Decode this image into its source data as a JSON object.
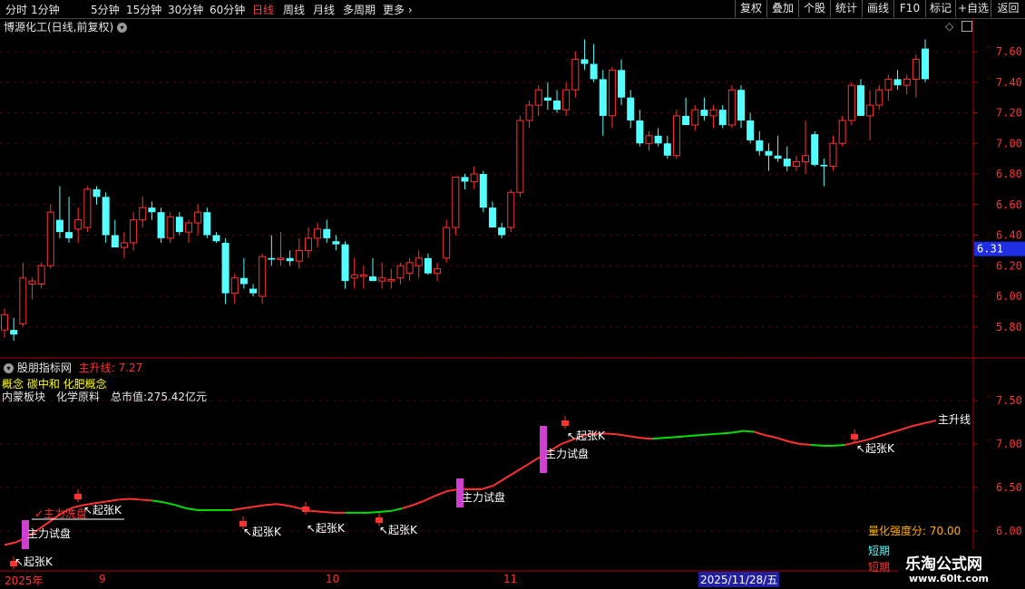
{
  "toolbar": {
    "periods": [
      "分时",
      "1分钟",
      "5分钟",
      "15分钟",
      "30分钟",
      "60分钟",
      "日线",
      "周线",
      "月线",
      "多周期",
      "更多 ›"
    ],
    "active_period": "日线",
    "right_buttons": [
      "复权",
      "叠加",
      "个股",
      "统计",
      "画线",
      "F10",
      "标记",
      "+自选",
      "返回"
    ]
  },
  "main_chart": {
    "title": "博源化工(日线,前复权)",
    "price_ticks": [
      "7.60",
      "7.40",
      "7.20",
      "7.00",
      "6.80",
      "6.60",
      "6.40",
      "6.20",
      "6.00",
      "5.80"
    ],
    "current_price": "6.31",
    "candles": [
      {
        "o": 5.78,
        "h": 5.92,
        "l": 5.73,
        "c": 5.88
      },
      {
        "o": 5.78,
        "h": 5.86,
        "l": 5.71,
        "c": 5.75
      },
      {
        "o": 5.82,
        "h": 6.22,
        "l": 5.8,
        "c": 6.12
      },
      {
        "o": 6.08,
        "h": 6.12,
        "l": 5.98,
        "c": 6.1
      },
      {
        "o": 6.08,
        "h": 6.22,
        "l": 6.05,
        "c": 6.2
      },
      {
        "o": 6.2,
        "h": 6.6,
        "l": 6.18,
        "c": 6.55
      },
      {
        "o": 6.5,
        "h": 6.72,
        "l": 6.38,
        "c": 6.42
      },
      {
        "o": 6.42,
        "h": 6.65,
        "l": 6.35,
        "c": 6.38
      },
      {
        "o": 6.44,
        "h": 6.58,
        "l": 6.35,
        "c": 6.5
      },
      {
        "o": 6.45,
        "h": 6.72,
        "l": 6.42,
        "c": 6.7
      },
      {
        "o": 6.7,
        "h": 6.72,
        "l": 6.6,
        "c": 6.65
      },
      {
        "o": 6.65,
        "h": 6.68,
        "l": 6.35,
        "c": 6.4
      },
      {
        "o": 6.4,
        "h": 6.5,
        "l": 6.33,
        "c": 6.32
      },
      {
        "o": 6.32,
        "h": 6.42,
        "l": 6.25,
        "c": 6.35
      },
      {
        "o": 6.35,
        "h": 6.55,
        "l": 6.3,
        "c": 6.5
      },
      {
        "o": 6.5,
        "h": 6.65,
        "l": 6.45,
        "c": 6.58
      },
      {
        "o": 6.58,
        "h": 6.62,
        "l": 6.5,
        "c": 6.55
      },
      {
        "o": 6.55,
        "h": 6.58,
        "l": 6.35,
        "c": 6.38
      },
      {
        "o": 6.38,
        "h": 6.55,
        "l": 6.35,
        "c": 6.52
      },
      {
        "o": 6.52,
        "h": 6.55,
        "l": 6.4,
        "c": 6.42
      },
      {
        "o": 6.42,
        "h": 6.5,
        "l": 6.35,
        "c": 6.48
      },
      {
        "o": 6.48,
        "h": 6.6,
        "l": 6.4,
        "c": 6.55
      },
      {
        "o": 6.55,
        "h": 6.58,
        "l": 6.38,
        "c": 6.4
      },
      {
        "o": 6.4,
        "h": 6.42,
        "l": 6.35,
        "c": 6.36
      },
      {
        "o": 6.35,
        "h": 6.38,
        "l": 5.95,
        "c": 6.02
      },
      {
        "o": 6.02,
        "h": 6.15,
        "l": 5.95,
        "c": 6.12
      },
      {
        "o": 6.12,
        "h": 6.25,
        "l": 6.05,
        "c": 6.08
      },
      {
        "o": 6.05,
        "h": 6.08,
        "l": 6.0,
        "c": 6.02
      },
      {
        "o": 6.0,
        "h": 6.28,
        "l": 5.95,
        "c": 6.26
      },
      {
        "o": 6.25,
        "h": 6.4,
        "l": 6.2,
        "c": 6.24
      },
      {
        "o": 6.24,
        "h": 6.42,
        "l": 6.2,
        "c": 6.25
      },
      {
        "o": 6.25,
        "h": 6.3,
        "l": 6.2,
        "c": 6.23
      },
      {
        "o": 6.23,
        "h": 6.38,
        "l": 6.18,
        "c": 6.3
      },
      {
        "o": 6.3,
        "h": 6.45,
        "l": 6.25,
        "c": 6.38
      },
      {
        "o": 6.38,
        "h": 6.48,
        "l": 6.32,
        "c": 6.44
      },
      {
        "o": 6.44,
        "h": 6.5,
        "l": 6.35,
        "c": 6.38
      },
      {
        "o": 6.36,
        "h": 6.4,
        "l": 6.3,
        "c": 6.34
      },
      {
        "o": 6.34,
        "h": 6.36,
        "l": 6.05,
        "c": 6.1
      },
      {
        "o": 6.12,
        "h": 6.25,
        "l": 6.05,
        "c": 6.14
      },
      {
        "o": 6.13,
        "h": 6.2,
        "l": 6.05,
        "c": 6.14
      },
      {
        "o": 6.13,
        "h": 6.25,
        "l": 6.1,
        "c": 6.1
      },
      {
        "o": 6.1,
        "h": 6.22,
        "l": 6.05,
        "c": 6.12
      },
      {
        "o": 6.1,
        "h": 6.18,
        "l": 6.05,
        "c": 6.11
      },
      {
        "o": 6.12,
        "h": 6.22,
        "l": 6.08,
        "c": 6.2
      },
      {
        "o": 6.15,
        "h": 6.25,
        "l": 6.1,
        "c": 6.22
      },
      {
        "o": 6.2,
        "h": 6.3,
        "l": 6.12,
        "c": 6.25
      },
      {
        "o": 6.25,
        "h": 6.28,
        "l": 6.14,
        "c": 6.15
      },
      {
        "o": 6.15,
        "h": 6.22,
        "l": 6.1,
        "c": 6.18
      },
      {
        "o": 6.25,
        "h": 6.5,
        "l": 6.22,
        "c": 6.45
      },
      {
        "o": 6.45,
        "h": 6.78,
        "l": 6.4,
        "c": 6.78
      },
      {
        "o": 6.78,
        "h": 6.8,
        "l": 6.7,
        "c": 6.75
      },
      {
        "o": 6.75,
        "h": 6.85,
        "l": 6.7,
        "c": 6.8
      },
      {
        "o": 6.8,
        "h": 6.82,
        "l": 6.55,
        "c": 6.58
      },
      {
        "o": 6.58,
        "h": 6.62,
        "l": 6.45,
        "c": 6.45
      },
      {
        "o": 6.45,
        "h": 6.48,
        "l": 6.38,
        "c": 6.4
      },
      {
        "o": 6.45,
        "h": 6.7,
        "l": 6.42,
        "c": 6.68
      },
      {
        "o": 6.68,
        "h": 7.18,
        "l": 6.65,
        "c": 7.15
      },
      {
        "o": 7.15,
        "h": 7.28,
        "l": 7.1,
        "c": 7.25
      },
      {
        "o": 7.25,
        "h": 7.38,
        "l": 7.18,
        "c": 7.35
      },
      {
        "o": 7.3,
        "h": 7.4,
        "l": 7.22,
        "c": 7.28
      },
      {
        "o": 7.28,
        "h": 7.35,
        "l": 7.2,
        "c": 7.22
      },
      {
        "o": 7.22,
        "h": 7.4,
        "l": 7.18,
        "c": 7.35
      },
      {
        "o": 7.35,
        "h": 7.6,
        "l": 7.3,
        "c": 7.55
      },
      {
        "o": 7.55,
        "h": 7.68,
        "l": 7.48,
        "c": 7.52
      },
      {
        "o": 7.52,
        "h": 7.65,
        "l": 7.4,
        "c": 7.42
      },
      {
        "o": 7.42,
        "h": 7.48,
        "l": 7.05,
        "c": 7.18
      },
      {
        "o": 7.18,
        "h": 7.5,
        "l": 7.1,
        "c": 7.48
      },
      {
        "o": 7.48,
        "h": 7.55,
        "l": 7.25,
        "c": 7.3
      },
      {
        "o": 7.3,
        "h": 7.35,
        "l": 7.1,
        "c": 7.15
      },
      {
        "o": 7.15,
        "h": 7.22,
        "l": 6.98,
        "c": 7.0
      },
      {
        "o": 7.0,
        "h": 7.08,
        "l": 6.95,
        "c": 7.05
      },
      {
        "o": 7.05,
        "h": 7.1,
        "l": 6.98,
        "c": 7.0
      },
      {
        "o": 7.0,
        "h": 7.05,
        "l": 6.9,
        "c": 6.92
      },
      {
        "o": 6.92,
        "h": 7.22,
        "l": 6.9,
        "c": 7.18
      },
      {
        "o": 7.18,
        "h": 7.3,
        "l": 7.12,
        "c": 7.12
      },
      {
        "o": 7.12,
        "h": 7.25,
        "l": 7.08,
        "c": 7.22
      },
      {
        "o": 7.22,
        "h": 7.3,
        "l": 7.15,
        "c": 7.18
      },
      {
        "o": 7.18,
        "h": 7.25,
        "l": 7.1,
        "c": 7.22
      },
      {
        "o": 7.22,
        "h": 7.25,
        "l": 7.1,
        "c": 7.12
      },
      {
        "o": 7.12,
        "h": 7.38,
        "l": 7.1,
        "c": 7.35
      },
      {
        "o": 7.35,
        "h": 7.38,
        "l": 7.1,
        "c": 7.15
      },
      {
        "o": 7.15,
        "h": 7.2,
        "l": 7.0,
        "c": 7.02
      },
      {
        "o": 7.02,
        "h": 7.08,
        "l": 6.92,
        "c": 6.95
      },
      {
        "o": 6.95,
        "h": 7.0,
        "l": 6.82,
        "c": 6.92
      },
      {
        "o": 6.92,
        "h": 7.05,
        "l": 6.88,
        "c": 6.9
      },
      {
        "o": 6.9,
        "h": 6.98,
        "l": 6.82,
        "c": 6.85
      },
      {
        "o": 6.85,
        "h": 6.92,
        "l": 6.82,
        "c": 6.88
      },
      {
        "o": 6.88,
        "h": 7.15,
        "l": 6.8,
        "c": 6.92
      },
      {
        "o": 7.06,
        "h": 7.08,
        "l": 6.85,
        "c": 6.86
      },
      {
        "o": 6.86,
        "h": 6.9,
        "l": 6.72,
        "c": 6.85
      },
      {
        "o": 6.85,
        "h": 7.05,
        "l": 6.82,
        "c": 7.0
      },
      {
        "o": 7.0,
        "h": 7.18,
        "l": 6.98,
        "c": 7.15
      },
      {
        "o": 7.15,
        "h": 7.4,
        "l": 7.12,
        "c": 7.38
      },
      {
        "o": 7.38,
        "h": 7.42,
        "l": 7.18,
        "c": 7.18
      },
      {
        "o": 7.18,
        "h": 7.35,
        "l": 7.02,
        "c": 7.25
      },
      {
        "o": 7.25,
        "h": 7.38,
        "l": 7.22,
        "c": 7.35
      },
      {
        "o": 7.35,
        "h": 7.45,
        "l": 7.28,
        "c": 7.42
      },
      {
        "o": 7.42,
        "h": 7.48,
        "l": 7.35,
        "c": 7.38
      },
      {
        "o": 7.38,
        "h": 7.45,
        "l": 7.32,
        "c": 7.42
      },
      {
        "o": 7.42,
        "h": 7.58,
        "l": 7.3,
        "c": 7.55
      },
      {
        "o": 7.62,
        "h": 7.68,
        "l": 7.4,
        "c": 7.42
      }
    ]
  },
  "indicator": {
    "name": "股朋指标网",
    "line_label": "主升线",
    "line_value": "7.27",
    "concept_text": "概念 碳中和 化肥概念",
    "sector_text": "内蒙板块　化学原料　总市值:275.42亿元",
    "ticks": [
      "7.50",
      "7.00",
      "6.50",
      "6.00"
    ],
    "line_values": [
      5.84,
      5.87,
      5.93,
      6.02,
      6.11,
      6.2,
      6.27,
      6.3,
      6.32,
      6.34,
      6.36,
      6.37,
      6.36,
      6.35,
      6.33,
      6.3,
      6.26,
      6.24,
      6.24,
      6.24,
      6.24,
      6.26,
      6.28,
      6.3,
      6.31,
      6.29,
      6.26,
      6.23,
      6.22,
      6.21,
      6.21,
      6.21,
      6.21,
      6.22,
      6.23,
      6.26,
      6.3,
      6.35,
      6.41,
      6.46,
      6.48,
      6.48,
      6.48,
      6.52,
      6.6,
      6.68,
      6.76,
      6.84,
      6.92,
      7.0,
      7.05,
      7.1,
      7.12,
      7.12,
      7.11,
      7.09,
      7.07,
      7.06,
      7.07,
      7.08,
      7.09,
      7.1,
      7.11,
      7.12,
      7.13,
      7.15,
      7.14,
      7.1,
      7.07,
      7.03,
      7.0,
      6.99,
      6.98,
      6.98,
      6.99,
      7.02,
      7.05,
      7.09,
      7.13,
      7.17,
      7.21,
      7.24,
      7.27
    ],
    "green_ranges": [
      [
        13,
        20
      ],
      [
        30,
        35
      ],
      [
        57,
        66
      ],
      [
        71,
        74
      ]
    ],
    "markers_qizhang": [
      "起张K",
      "起张K",
      "起张K",
      "起张K",
      "起张K",
      "起张K",
      "起张K"
    ],
    "marker_shitai": "主力试盘",
    "marker_xipan": "主力洗盘",
    "end_label": "主升线",
    "score_label": "量化强度分: 70.00",
    "short_term_1": "短期",
    "short_term_2": "短期"
  },
  "xaxis": {
    "labels": [
      "2025年",
      "9",
      "10",
      "11"
    ],
    "highlight_date": "2025/11/28/五"
  },
  "watermark": {
    "name": "乐淘公式网",
    "url": "www.60lt.com"
  },
  "colors": {
    "up": "#ff3232",
    "down": "#54ffff",
    "grid": "#7a0000",
    "axis": "#b00000",
    "green": "#00e000",
    "text_yellow": "#ffff00",
    "orange": "#ffb000"
  }
}
